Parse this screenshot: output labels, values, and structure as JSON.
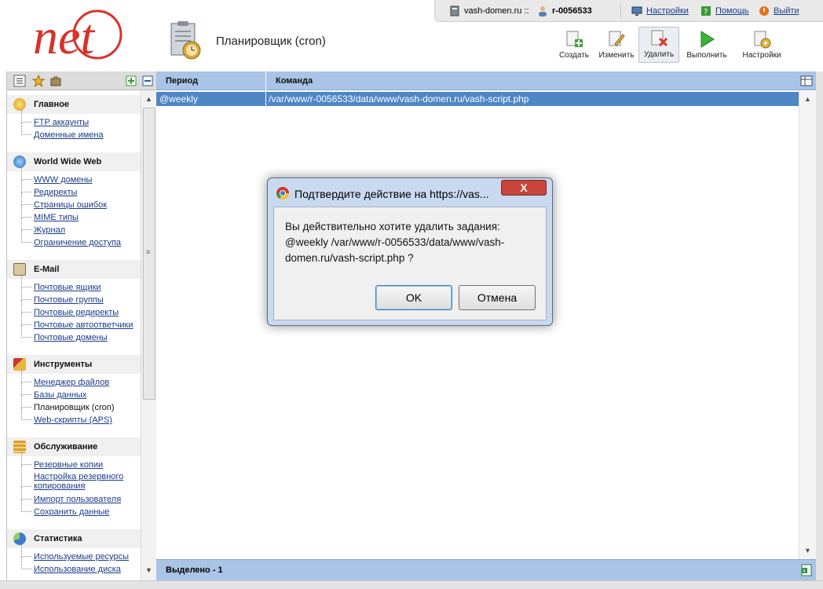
{
  "header": {
    "logo_text": "net",
    "domain": "vash-domen.ru ::",
    "user": "r-0056533",
    "settings_link": "Настройки",
    "help_link": "Помощь",
    "logout_link": "Выйти",
    "page_title": "Планировщик (cron)"
  },
  "toolbar": {
    "create": "Создать",
    "edit": "Изменить",
    "delete": "Удалить",
    "run": "Выполнить",
    "settings": "Настройки"
  },
  "sidebar": {
    "sections": [
      {
        "title": "Главное",
        "items": [
          "FTP аккаунты",
          "Доменные имена"
        ]
      },
      {
        "title": "World Wide Web",
        "items": [
          "WWW домены",
          "Редиректы",
          "Страницы ошибок",
          "MIME типы",
          "Журнал",
          "Ограничение доступа"
        ]
      },
      {
        "title": "E-Mail",
        "items": [
          "Почтовые ящики",
          "Почтовые группы",
          "Почтовые редиректы",
          "Почтовые автоответчики",
          "Почтовые домены"
        ]
      },
      {
        "title": "Инструменты",
        "items": [
          "Менеджер файлов",
          "Базы данных",
          "Планировщик (cron)",
          "Web-скрипты (APS)"
        ]
      },
      {
        "title": "Обслуживание",
        "items": [
          "Резервные копии",
          "Настройка резервного копирования",
          "Импорт пользователя",
          "Сохранить данные"
        ]
      },
      {
        "title": "Статистика",
        "items": [
          "Используемые ресурсы",
          "Использование диска"
        ]
      }
    ]
  },
  "grid": {
    "columns": [
      "Период",
      "Команда"
    ],
    "rows": [
      {
        "period": "@weekly",
        "command": "/var/www/r-0056533/data/www/vash-domen.ru/vash-script.php"
      }
    ],
    "footer": "Выделено - 1"
  },
  "dialog": {
    "title": "Подтвердите действие на https://vas...",
    "message": "Вы действительно хотите удалить задания: @weekly /var/www/r-0056533/data/www/vash-domen.ru/vash-script.php ?",
    "ok": "OK",
    "cancel": "Отмена",
    "close": "X"
  },
  "colors": {
    "grid_header": "#a9c4e6",
    "selected_row": "#4e86c6",
    "logo_red": "#d8322a",
    "link": "#1b3c8a"
  }
}
